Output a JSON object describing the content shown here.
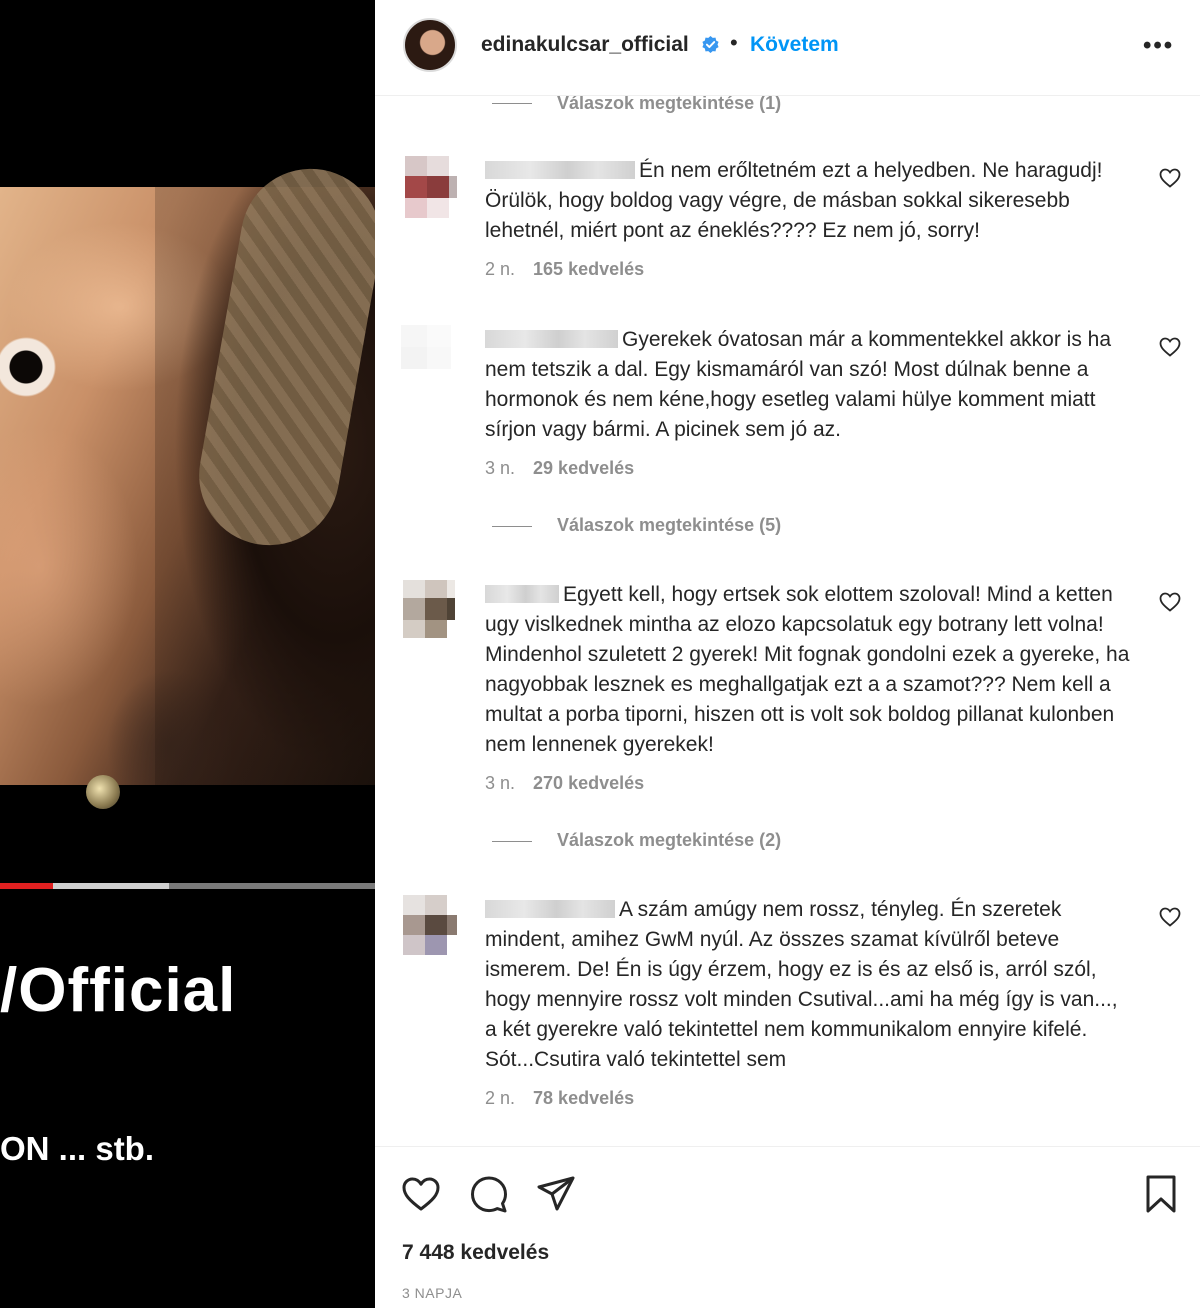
{
  "media": {
    "title_fragment": "/Official",
    "tags_fragment": "ON  ... stb.",
    "video_progress": 0.14,
    "video_buffered": 0.45
  },
  "header": {
    "username": "edinakulcsar_official",
    "verified": true,
    "separator": "•",
    "follow_label": "Követem",
    "more_label": "•••"
  },
  "comments": {
    "top_reply_link": "Válaszok megtekintése (1)",
    "items": [
      {
        "text": "Én nem erőltetném ezt a helyedben. Ne haragudj! Örülök, hogy boldog vagy végre, de másban sokkal sikeresebb lehetnél, miért pont az éneklés???? Ez nem jó, sorry!",
        "age": "2 n.",
        "likes": "165 kedvelés"
      },
      {
        "text": "Gyerekek óvatosan már a kommentekkel akkor is ha nem tetszik a dal. Egy kismamáról van szó! Most dúlnak benne a hormonok és nem kéne,hogy esetleg valami hülye komment miatt sírjon vagy bármi. A picinek sem jó az.",
        "age": "3 n.",
        "likes": "29 kedvelés",
        "replies": "Válaszok megtekintése (5)"
      },
      {
        "text": "Egyett kell, hogy ertsek sok elottem szoloval! Mind a ketten ugy vislkednek mintha az elozo kapcsolatuk egy botrany lett volna! Mindenhol szuletett 2 gyerek! Mit fognak gondolni ezek a gyereke, ha nagyobbak lesznek es meghallgatjak ezt a a szamot??? Nem kell a multat a porba tiporni, hiszen ott is volt sok boldog pillanat kulonben nem lennenek gyerekek!",
        "age": "3 n.",
        "likes": "270 kedvelés",
        "replies": "Válaszok megtekintése (2)"
      },
      {
        "text": "A szám amúgy nem rossz, tényleg. Én szeretek mindent, amihez GwM nyúl. Az összes szamat kívülről beteve ismerem. De! Én is úgy érzem, hogy ez is és az első is, arról szól, hogy mennyire rossz volt minden Csutival...ami ha még így is van..., a két gyerekre való tekintettel nem kommunikalom ennyire kifelé. Sót...Csutira való tekintettel sem",
        "age": "2 n.",
        "likes": "78 kedvelés"
      }
    ]
  },
  "footer": {
    "likes_total": "7 448 kedvelés",
    "timestamp": "3 NAPJA"
  },
  "colors": {
    "link_blue": "#0095f6",
    "muted_gray": "#8e8e8e",
    "text_dark": "#262626",
    "progress_red": "#e02020"
  },
  "icons": [
    "verified-badge-icon",
    "more-options-icon",
    "heart-icon",
    "comment-icon",
    "share-icon",
    "bookmark-icon"
  ]
}
